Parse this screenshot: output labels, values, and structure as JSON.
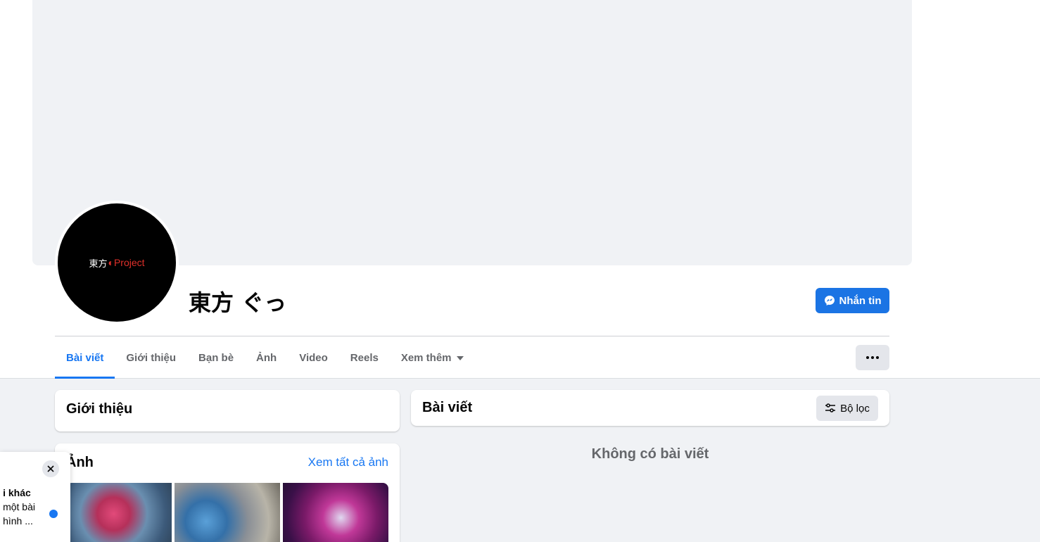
{
  "profile": {
    "name": "東方 ぐっ",
    "avatar_text_white": "東方",
    "avatar_text_red": "Project",
    "message_button": "Nhắn tin"
  },
  "tabs": [
    {
      "label": "Bài viết",
      "active": true
    },
    {
      "label": "Giới thiệu",
      "active": false
    },
    {
      "label": "Bạn bè",
      "active": false
    },
    {
      "label": "Ảnh",
      "active": false
    },
    {
      "label": "Video",
      "active": false
    },
    {
      "label": "Reels",
      "active": false
    },
    {
      "label": "Xem thêm",
      "active": false
    }
  ],
  "intro_card": {
    "title": "Giới thiệu"
  },
  "photos_card": {
    "title": "Ảnh",
    "see_all": "Xem tất cả ảnh",
    "photos": [
      "shrimp-photo",
      "shrimp-rock-photo",
      "anime-art-photo"
    ]
  },
  "posts_card": {
    "title": "Bài viết",
    "filter_button": "Bộ lọc",
    "empty_message": "Không có bài viết"
  },
  "notification": {
    "line1": "i khác",
    "line2": "một bài",
    "line3": "hình ..."
  },
  "colors": {
    "accent": "#1877f2",
    "button_primary": "#1b74e4",
    "secondary_button": "#e4e6eb",
    "page_background": "#f0f2f5",
    "secondary_text": "#65676b"
  }
}
